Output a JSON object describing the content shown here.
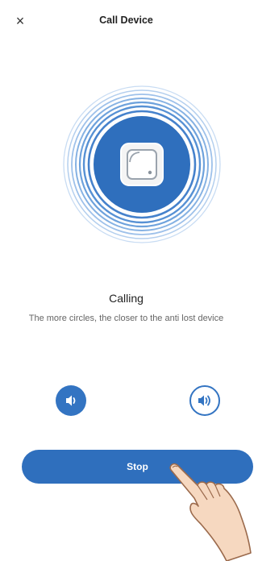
{
  "header": {
    "close_icon": "×",
    "title": "Call Device"
  },
  "radar": {
    "device_icon": "device-tag-icon",
    "accent_color": "#2f6fbd"
  },
  "status": {
    "label": "Calling",
    "hint": "The more circles, the closer to the anti lost device"
  },
  "volume": {
    "down_icon": "volume-down-icon",
    "up_icon": "volume-up-icon"
  },
  "actions": {
    "stop_label": "Stop"
  },
  "overlay": {
    "hand_icon": "pointing-hand-icon"
  }
}
